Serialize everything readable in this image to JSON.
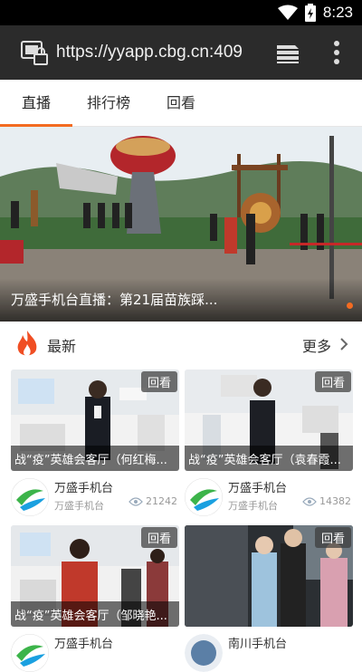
{
  "status_bar": {
    "time": "8:23",
    "icons": [
      "wifi-icon",
      "battery-icon"
    ]
  },
  "address_bar": {
    "url": "https://yyapp.cbg.cn:409",
    "icons": [
      "site-info-icon",
      "tabs-icon",
      "overflow-menu-icon"
    ]
  },
  "tabs": [
    {
      "label": "直播",
      "active": true
    },
    {
      "label": "排行榜",
      "active": false
    },
    {
      "label": "回看",
      "active": false
    }
  ],
  "colors": {
    "accent": "#f36b21",
    "flame": "#f04e23",
    "logo_green": "#3cb44a",
    "logo_blue": "#1aa0e0"
  },
  "banner": {
    "caption": "万盛手机台直播：第21届苗族踩..."
  },
  "section": {
    "title": "最新",
    "more": "更多"
  },
  "cards": [
    {
      "badge": "回看",
      "caption": "战“疫”英雄会客厅（何红梅...",
      "channel": "万盛手机台",
      "sub": "万盛手机台",
      "views": "21242"
    },
    {
      "badge": "回看",
      "caption": "战“疫”英雄会客厅（袁春霞...",
      "channel": "万盛手机台",
      "sub": "万盛手机台",
      "views": "14382"
    },
    {
      "badge": "回看",
      "caption": "战“疫”英雄会客厅（邹晓艳...",
      "channel": "万盛手机台",
      "sub": "",
      "views": ""
    },
    {
      "badge": "回看",
      "caption": "",
      "channel": "南川手机台",
      "sub": "",
      "views": ""
    }
  ]
}
